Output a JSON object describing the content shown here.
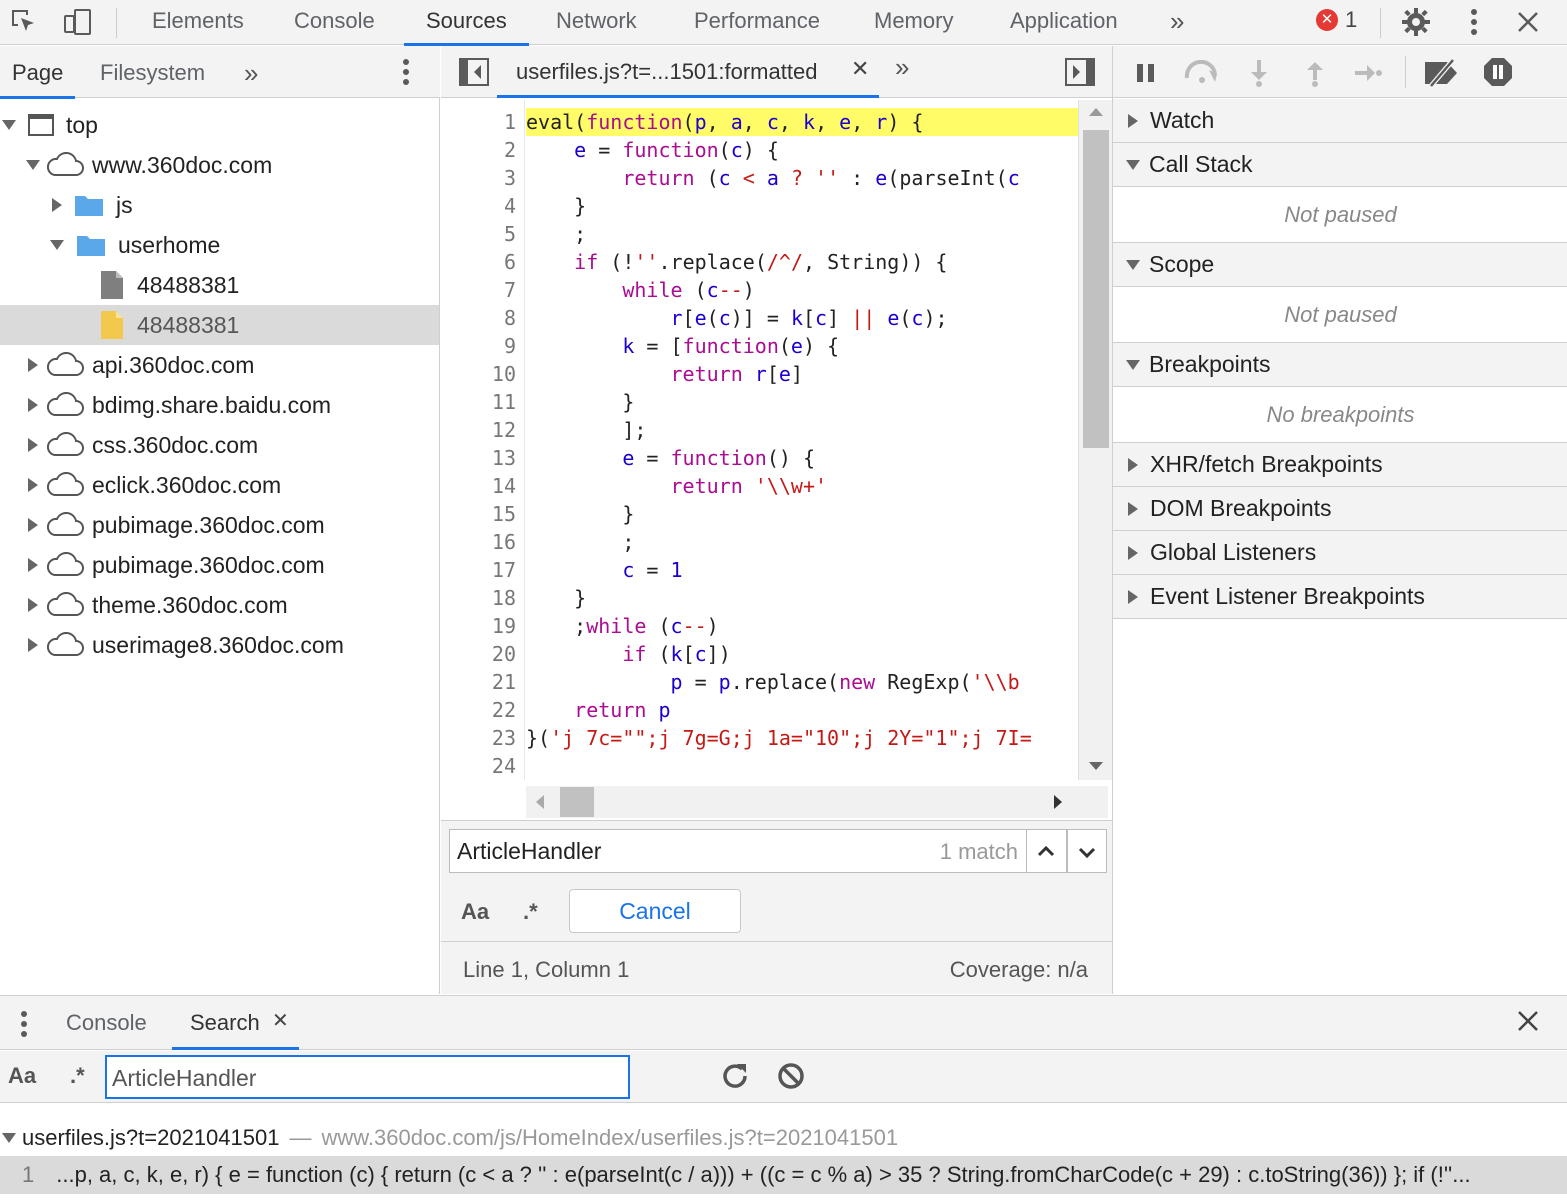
{
  "toolbar": {
    "tabs": [
      "Elements",
      "Console",
      "Sources",
      "Network",
      "Performance",
      "Memory",
      "Application"
    ],
    "active_tab": "Sources",
    "error_count": "1",
    "more_label": "»"
  },
  "navigator": {
    "tabs": [
      "Page",
      "Filesystem"
    ],
    "more_label": "»",
    "tree": [
      {
        "label": "top",
        "icon": "frame-icon",
        "expanded": true
      },
      {
        "label": "www.360doc.com",
        "icon": "cloud-icon",
        "expanded": true
      },
      {
        "label": "js",
        "icon": "folder-icon",
        "expanded": false
      },
      {
        "label": "userhome",
        "icon": "folder-icon",
        "expanded": true
      },
      {
        "label": "48488381",
        "icon": "file-icon"
      },
      {
        "label": "48488381",
        "icon": "script-file-icon",
        "selected": true
      },
      {
        "label": "api.360doc.com",
        "icon": "cloud-icon",
        "expanded": false
      },
      {
        "label": "bdimg.share.baidu.com",
        "icon": "cloud-icon",
        "expanded": false
      },
      {
        "label": "css.360doc.com",
        "icon": "cloud-icon",
        "expanded": false
      },
      {
        "label": "eclick.360doc.com",
        "icon": "cloud-icon",
        "expanded": false
      },
      {
        "label": "pubimage.360doc.com",
        "icon": "cloud-icon",
        "expanded": false
      },
      {
        "label": "pubimage.360doc.com",
        "icon": "cloud-icon",
        "expanded": false
      },
      {
        "label": "theme.360doc.com",
        "icon": "cloud-icon",
        "expanded": false
      },
      {
        "label": "userimage8.360doc.com",
        "icon": "cloud-icon",
        "expanded": false
      }
    ]
  },
  "editor": {
    "tab_title": "userfiles.js?t=...1501:formatted",
    "line_numbers": [
      "1",
      "2",
      "3",
      "4",
      "5",
      "6",
      "7",
      "8",
      "9",
      "10",
      "11",
      "12",
      "13",
      "14",
      "15",
      "16",
      "17",
      "18",
      "19",
      "20",
      "21",
      "22",
      "23",
      "24"
    ],
    "find": {
      "query": "ArticleHandler",
      "match_count": "1 match",
      "case_label": "Aa",
      "regex_label": ".*",
      "cancel_label": "Cancel"
    },
    "status": {
      "position": "Line 1, Column 1",
      "coverage": "Coverage: n/a"
    }
  },
  "debugger": {
    "sections": [
      {
        "title": "Watch",
        "expanded": false
      },
      {
        "title": "Call Stack",
        "expanded": true,
        "body": "Not paused"
      },
      {
        "title": "Scope",
        "expanded": true,
        "body": "Not paused"
      },
      {
        "title": "Breakpoints",
        "expanded": true,
        "body": "No breakpoints"
      },
      {
        "title": "XHR/fetch Breakpoints",
        "expanded": false
      },
      {
        "title": "DOM Breakpoints",
        "expanded": false
      },
      {
        "title": "Global Listeners",
        "expanded": false
      },
      {
        "title": "Event Listener Breakpoints",
        "expanded": false
      }
    ]
  },
  "drawer": {
    "tabs": [
      "Console",
      "Search"
    ],
    "active_tab": "Search",
    "search": {
      "case_label": "Aa",
      "regex_label": ".*",
      "query": "ArticleHandler"
    },
    "result": {
      "file": "userfiles.js?t=2021041501",
      "separator": "—",
      "url": "www.360doc.com/js/HomeIndex/userfiles.js?t=2021041501",
      "line_number": "1",
      "line_text": "...p, a, c, k, e, r) { e = function (c) { return (c < a ? '' : e(parseInt(c / a))) + ((c = c % a) > 35 ? String.fromCharCode(c + 29) : c.toString(36)) }; if (!''..."
    }
  }
}
